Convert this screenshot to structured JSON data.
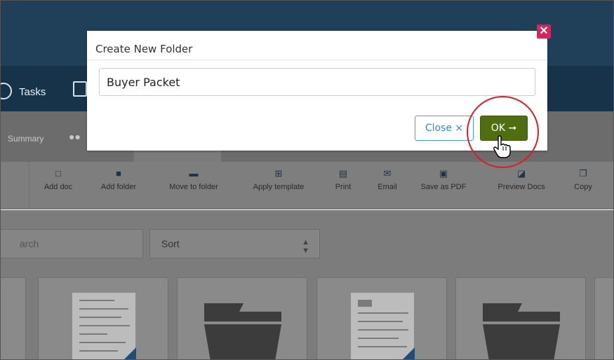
{
  "nav": {
    "tasks_label": "Tasks"
  },
  "subnav": {
    "summary_label": "Summary"
  },
  "toolbar": {
    "items": [
      {
        "label": "Add doc",
        "icon": "add-doc-icon"
      },
      {
        "label": "Add folder",
        "icon": "add-folder-icon"
      },
      {
        "label": "Move to folder",
        "icon": "folder-icon"
      },
      {
        "label": "Apply template",
        "icon": "template-grid-icon"
      },
      {
        "label": "Print",
        "icon": "printer-icon"
      },
      {
        "label": "Email",
        "icon": "email-icon"
      },
      {
        "label": "Save as PDF",
        "icon": "pdf-icon"
      },
      {
        "label": "Preview Docs",
        "icon": "preview-icon"
      },
      {
        "label": "Copy",
        "icon": "copy-icon"
      }
    ]
  },
  "filters": {
    "search_placeholder": "arch",
    "sort_label": "Sort"
  },
  "modal": {
    "title": "Create New Folder",
    "input_value": "Buyer Packet",
    "close_label": "Close",
    "ok_label": "OK",
    "close_x_icon": "close-icon"
  },
  "colors": {
    "ok_button": "#4f6e10",
    "close_button_border": "#3fa6d9",
    "highlight": "#d81e26",
    "modal_close": "#d6245c"
  }
}
